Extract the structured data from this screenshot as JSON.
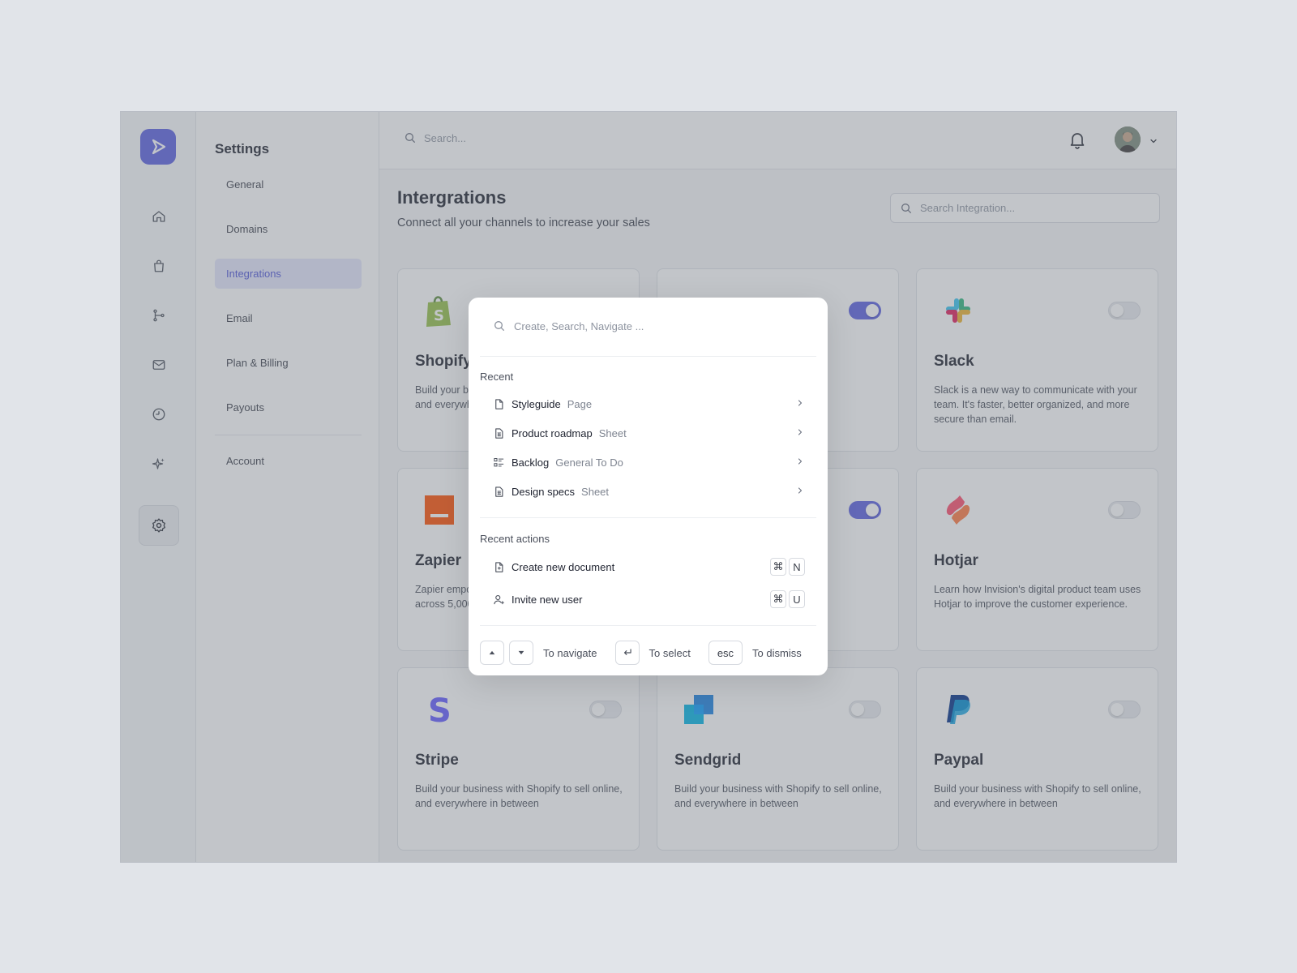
{
  "settings_nav": {
    "title": "Settings",
    "items": [
      {
        "label": "General"
      },
      {
        "label": "Domains"
      },
      {
        "label": "Integrations",
        "active": true
      },
      {
        "label": "Email"
      },
      {
        "label": "Plan & Billing"
      },
      {
        "label": "Payouts"
      },
      {
        "label": "Account"
      }
    ]
  },
  "rail": {
    "icons": [
      "home-icon",
      "shopping-bag-icon",
      "git-branch-icon",
      "mail-icon",
      "clock-icon",
      "sparkle-icon",
      "gear-icon"
    ],
    "active": "gear-icon"
  },
  "topbar": {
    "search_placeholder": "Search...",
    "icons": [
      "search-icon",
      "bell-icon",
      "avatar",
      "chevron-down-icon"
    ]
  },
  "page": {
    "title": "Intergrations",
    "subtitle": "Connect all your channels to increase your sales",
    "search_placeholder": "Search Integration..."
  },
  "integrations": [
    {
      "name": "Shopify",
      "description": "Build your business with Shopify to sell online, and everywhere in between",
      "enabled": false,
      "color": "#95bf47"
    },
    {
      "name": "",
      "description": "",
      "enabled": true,
      "color": "#1f2330"
    },
    {
      "name": "Slack",
      "description": "Slack is a new way to communicate with your team. It's faster, better organized, and more secure than email.",
      "enabled": false,
      "color": "#e01e5a"
    },
    {
      "name": "Zapier",
      "description": "Zapier empowers you to automate your work across 5,000+ apps so you can move forward",
      "enabled": false,
      "color": "#ff4f00"
    },
    {
      "name": "",
      "description": "",
      "enabled": true,
      "color": "#5a5fe0"
    },
    {
      "name": "Hotjar",
      "description": "Learn how Invision's digital product team uses Hotjar to improve the customer experience.",
      "enabled": false,
      "color": "#fd3a5c"
    },
    {
      "name": "Stripe",
      "description": "Build your business with Shopify to sell online, and everywhere in between",
      "enabled": false,
      "color": "#635bff"
    },
    {
      "name": "Sendgrid",
      "description": "Build your business with Shopify to sell online, and everywhere in between",
      "enabled": false,
      "color": "#1a82e2"
    },
    {
      "name": "Paypal",
      "description": "Build your business with Shopify to sell online, and everywhere in between",
      "enabled": false,
      "color": "#003087"
    }
  ],
  "palette": {
    "placeholder": "Create, Search, Navigate ...",
    "recent_heading": "Recent",
    "recent": [
      {
        "title": "Styleguide",
        "type": "Page",
        "icon": "document-icon"
      },
      {
        "title": "Product roadmap",
        "type": "Sheet",
        "icon": "sheet-icon"
      },
      {
        "title": "Backlog",
        "type": "General To Do",
        "icon": "list-icon"
      },
      {
        "title": "Design specs",
        "type": "Sheet",
        "icon": "sheet-icon"
      }
    ],
    "actions_heading": "Recent actions",
    "actions": [
      {
        "title": "Create new document",
        "keys": [
          "⌘",
          "N"
        ],
        "icon": "document-add-icon"
      },
      {
        "title": "Invite new user",
        "keys": [
          "⌘",
          "U"
        ],
        "icon": "user-add-icon"
      }
    ],
    "footer": {
      "navigate_label": "To navigate",
      "select_label": "To select",
      "esc_key": "esc",
      "dismiss_label": "To dismiss"
    }
  },
  "colors": {
    "accent": "#5a5fe0",
    "overlay": "rgba(110,116,126,0.42)"
  }
}
